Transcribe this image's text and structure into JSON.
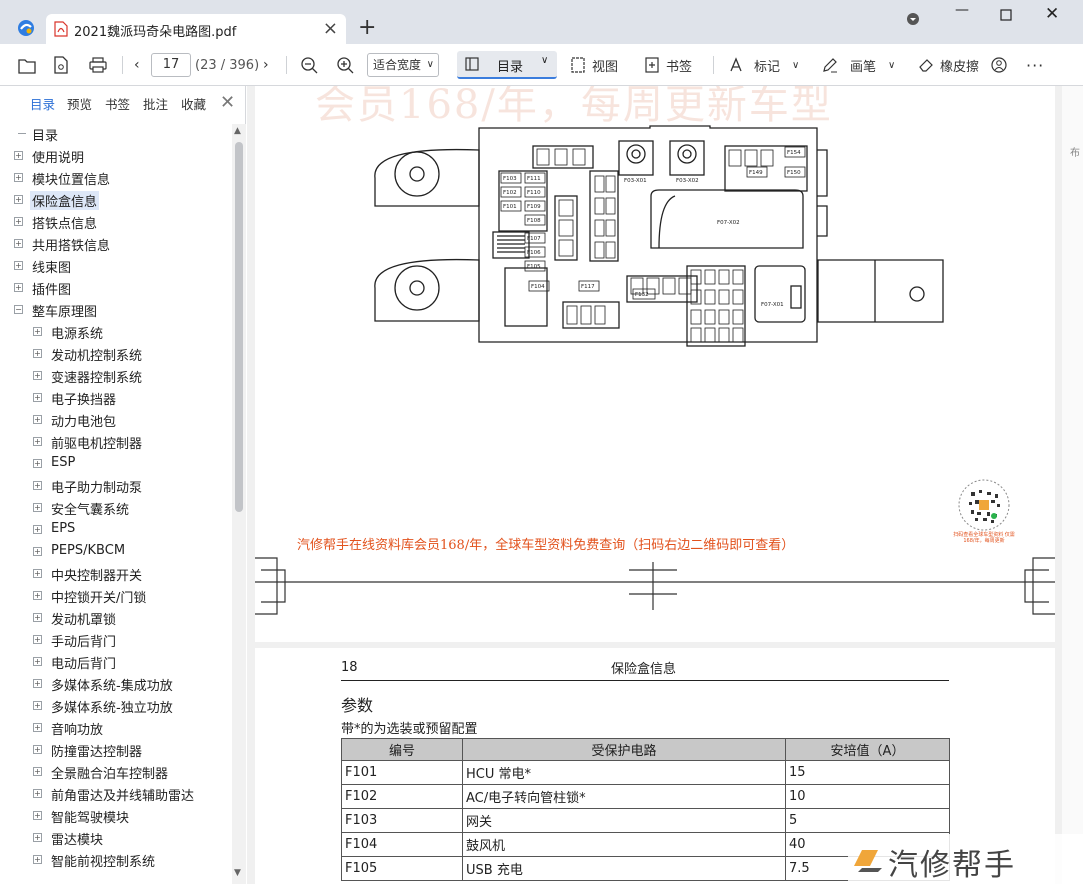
{
  "tab": {
    "title": "2021魏派玛奇朵电路图.pdf"
  },
  "toolbar": {
    "page_current": "17",
    "page_total": "(23 / 396)",
    "zoom": "适合宽度",
    "toc_label": "目录",
    "view_label": "视图",
    "bookmark_label": "书签",
    "mark_label": "标记",
    "pen_label": "画笔",
    "eraser_label": "橡皮擦"
  },
  "sidebar": {
    "tabs": [
      "目录",
      "预览",
      "书签",
      "批注",
      "收藏"
    ],
    "tree": [
      {
        "label": "目录",
        "level": 0,
        "expander": "none"
      },
      {
        "label": "使用说明",
        "level": 0,
        "expander": "plus"
      },
      {
        "label": "模块位置信息",
        "level": 0,
        "expander": "plus"
      },
      {
        "label": "保险盒信息",
        "level": 0,
        "expander": "plus",
        "selected": true
      },
      {
        "label": "搭铁点信息",
        "level": 0,
        "expander": "plus"
      },
      {
        "label": "共用搭铁信息",
        "level": 0,
        "expander": "plus"
      },
      {
        "label": "线束图",
        "level": 0,
        "expander": "plus"
      },
      {
        "label": "插件图",
        "level": 0,
        "expander": "plus"
      },
      {
        "label": "整车原理图",
        "level": 0,
        "expander": "minus"
      },
      {
        "label": "电源系统",
        "level": 1,
        "expander": "plus"
      },
      {
        "label": "发动机控制系统",
        "level": 1,
        "expander": "plus"
      },
      {
        "label": "变速器控制系统",
        "level": 1,
        "expander": "plus"
      },
      {
        "label": "电子换挡器",
        "level": 1,
        "expander": "plus"
      },
      {
        "label": "动力电池包",
        "level": 1,
        "expander": "plus"
      },
      {
        "label": "前驱电机控制器",
        "level": 1,
        "expander": "plus"
      },
      {
        "label": "ESP",
        "level": 1,
        "expander": "plus"
      },
      {
        "label": "电子助力制动泵",
        "level": 1,
        "expander": "plus"
      },
      {
        "label": "安全气囊系统",
        "level": 1,
        "expander": "plus"
      },
      {
        "label": "EPS",
        "level": 1,
        "expander": "plus"
      },
      {
        "label": "PEPS/KBCM",
        "level": 1,
        "expander": "plus"
      },
      {
        "label": "中央控制器开关",
        "level": 1,
        "expander": "plus"
      },
      {
        "label": "中控锁开关/门锁",
        "level": 1,
        "expander": "plus"
      },
      {
        "label": "发动机罩锁",
        "level": 1,
        "expander": "plus"
      },
      {
        "label": "手动后背门",
        "level": 1,
        "expander": "plus"
      },
      {
        "label": "电动后背门",
        "level": 1,
        "expander": "plus"
      },
      {
        "label": "多媒体系统-集成功放",
        "level": 1,
        "expander": "plus"
      },
      {
        "label": "多媒体系统-独立功放",
        "level": 1,
        "expander": "plus"
      },
      {
        "label": "音响功放",
        "level": 1,
        "expander": "plus"
      },
      {
        "label": "防撞雷达控制器",
        "level": 1,
        "expander": "plus"
      },
      {
        "label": "全景融合泊车控制器",
        "level": 1,
        "expander": "plus"
      },
      {
        "label": "前角雷达及并线辅助雷达",
        "level": 1,
        "expander": "plus"
      },
      {
        "label": "智能驾驶模块",
        "level": 1,
        "expander": "plus"
      },
      {
        "label": "雷达模块",
        "level": 1,
        "expander": "plus"
      },
      {
        "label": "智能前视控制系统",
        "level": 1,
        "expander": "plus"
      }
    ]
  },
  "page1": {
    "watermark": "会员168/年，每周更新车型",
    "promo": "汽修帮手在线资料库会员168/年，全球车型资料免费查询（扫码右边二维码即可查看）",
    "qr_caption": "扫码查看全球车型资料 仅需168/年，每周更新",
    "diagram_labels": {
      "f03x01": "F03-X01",
      "f03x02": "F03-X02",
      "f07x02": "F07-X02",
      "f07x01": "F07-X01",
      "fuses": [
        "F103",
        "F111",
        "F102",
        "F110",
        "F101",
        "F109",
        "F108",
        "F107",
        "F106",
        "F105",
        "F104",
        "F117",
        "F132",
        "F154",
        "F149",
        "F150"
      ]
    }
  },
  "page2": {
    "page_number": "18",
    "header_title": "保险盒信息",
    "section_title": "参数",
    "note": "带*的为选装或预留配置",
    "table": {
      "headers": [
        "编号",
        "受保护电路",
        "安培值（A）"
      ],
      "rows": [
        [
          "F101",
          "HCU 常电*",
          "15"
        ],
        [
          "F102",
          "AC/电子转向管柱锁*",
          "10"
        ],
        [
          "F103",
          "网关",
          "5"
        ],
        [
          "F104",
          "鼓风机",
          "40"
        ],
        [
          "F105",
          "USB 充电",
          "7.5"
        ]
      ]
    }
  },
  "brand": {
    "text": "汽修帮手"
  }
}
